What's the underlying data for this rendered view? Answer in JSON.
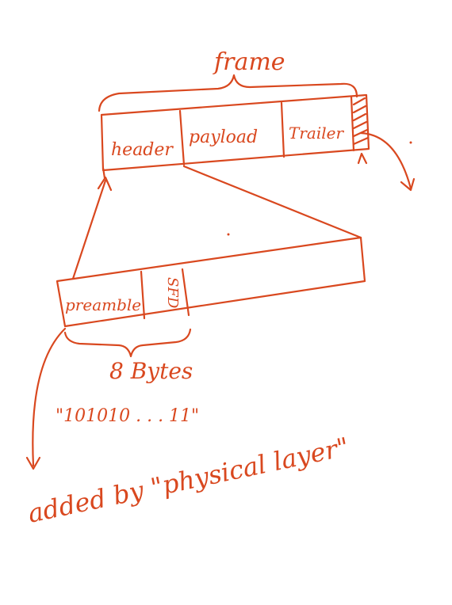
{
  "ink_color": "#d9481f",
  "labels": {
    "frame": "frame",
    "header": "header",
    "payload": "payload",
    "trailer": "Trailer",
    "preamble": "preamble",
    "sfd": "SFD",
    "byte_count": "8 Bytes",
    "bit_pattern": "\"101010 . . . 11\"",
    "note": "added by \"physical layer\""
  }
}
